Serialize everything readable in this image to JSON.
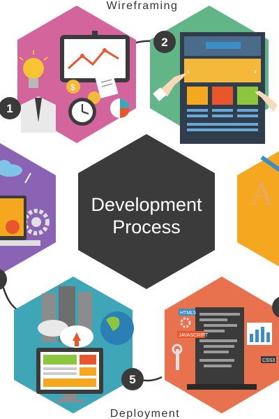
{
  "center": {
    "line1": "Development",
    "line2": "Process"
  },
  "stages": [
    {
      "number": "1",
      "label": ""
    },
    {
      "number": "2",
      "label": "Wireframing"
    },
    {
      "number": "5",
      "label": "Deployment"
    }
  ],
  "illustration_text": {
    "html": "HTML5",
    "javascript": "JAVASCRIPT",
    "css": "CSS3",
    "letter": "A"
  },
  "colors": {
    "center": "#3b3b3b",
    "pink": "#d4659c",
    "green": "#62b586",
    "purple": "#8a63b4",
    "orange": "#f4a71f",
    "teal": "#3fa6b8",
    "coral": "#e8714e",
    "badge": "#3a3a3a",
    "connector": "#333333"
  }
}
